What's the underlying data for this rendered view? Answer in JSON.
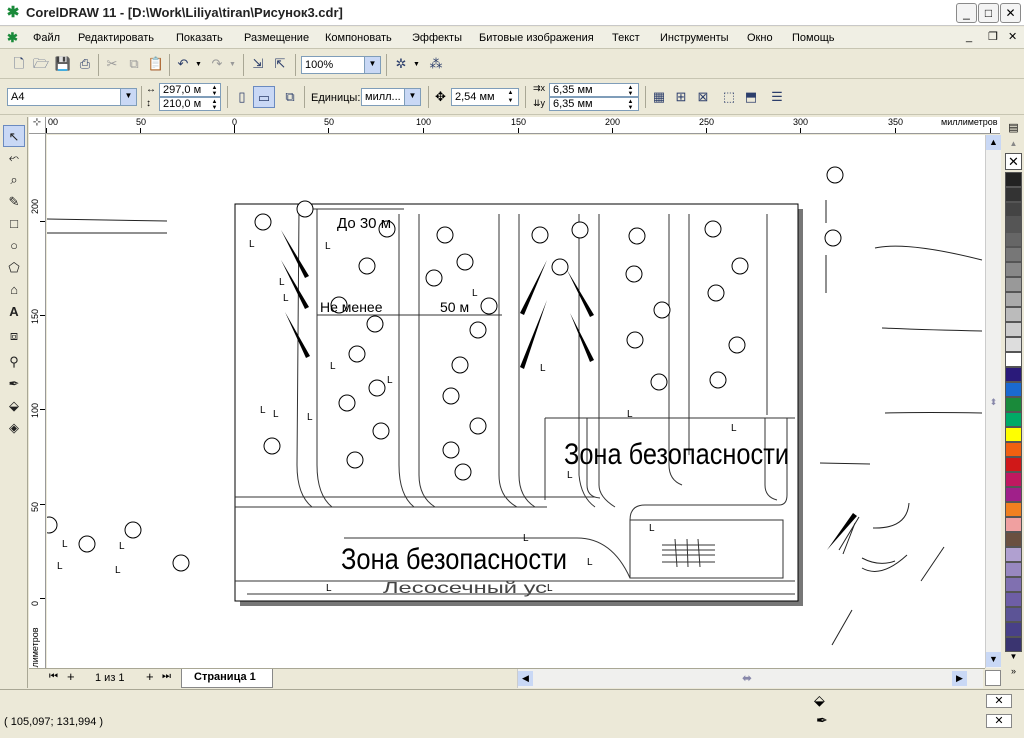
{
  "window": {
    "title": "CorelDRAW 11 - [D:\\Work\\Liliya\\tiran\\Рисунок3.cdr]",
    "buttons": {
      "minimize": "_",
      "maximize": "□",
      "close": "✕"
    }
  },
  "menu": {
    "items": [
      {
        "label": "Файл"
      },
      {
        "label": "Редактировать"
      },
      {
        "label": "Показать"
      },
      {
        "label": "Размещение"
      },
      {
        "label": "Компоновать"
      },
      {
        "label": "Эффекты"
      },
      {
        "label": "Битовые изображения"
      },
      {
        "label": "Текст"
      },
      {
        "label": "Инструменты"
      },
      {
        "label": "Окно"
      },
      {
        "label": "Помощь"
      }
    ],
    "doc_buttons": {
      "minimize": "_",
      "restore": "❐",
      "close": "✕"
    }
  },
  "standard_toolbar": {
    "zoom": "100%"
  },
  "property_bar": {
    "page_size": "A4",
    "width": "297,0 м",
    "height": "210,0 м",
    "units_label": "Единицы:",
    "units_value": "милл...",
    "nudge": "2,54 мм",
    "dup_x": "6,35 мм",
    "dup_y": "6,35 мм"
  },
  "rulers": {
    "units": "миллиметров",
    "h_ticks": [
      "00",
      "50",
      "0",
      "50",
      "100",
      "150",
      "200",
      "250",
      "300",
      "350"
    ],
    "v_ticks": [
      "200",
      "150",
      "100",
      "50",
      "0"
    ]
  },
  "drawing": {
    "label_up_to": "До 30 м",
    "label_not_less": "Не менее",
    "label_50": "50 м",
    "zone_upper": "Зона безопасности",
    "zone_lower": "Зона безопасности",
    "bottom_label": "Лесосечный ус"
  },
  "page_nav": {
    "counter": "1 из 1",
    "tab": "Страница 1"
  },
  "status": {
    "coords": "( 105,097; 131,994 )"
  },
  "palette": {
    "colors": [
      "#222222",
      "#333333",
      "#444444",
      "#555555",
      "#666666",
      "#777777",
      "#888888",
      "#999999",
      "#aaaaaa",
      "#bbbbbb",
      "#cccccc",
      "#dddddd",
      "#ffffff",
      "#2a1a7a",
      "#1a6ad0",
      "#1a8a3a",
      "#00aa66",
      "#ffff00",
      "#f06010",
      "#d01818",
      "#c01860",
      "#a0208a",
      "#f08020",
      "#f0a0a0",
      "#6a5040",
      "#b0a0d0",
      "#9888c0",
      "#8070b0",
      "#6e5ea6",
      "#5c5496",
      "#484088",
      "#3a3470"
    ]
  }
}
